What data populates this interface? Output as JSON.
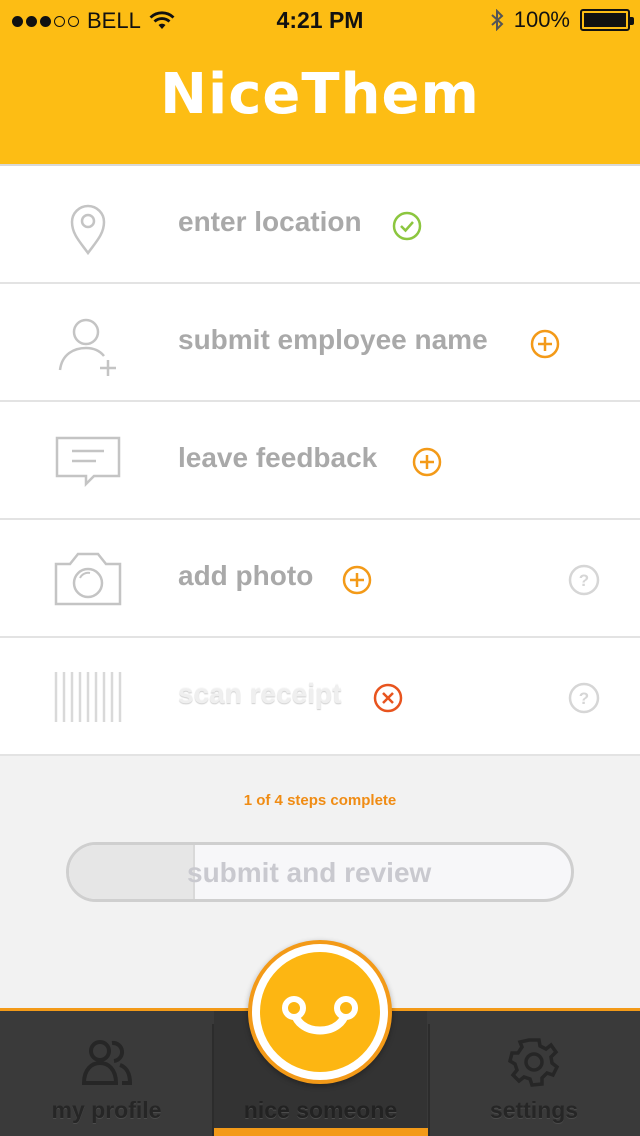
{
  "status_bar": {
    "carrier": "BELL",
    "time": "4:21 PM",
    "battery": "100%"
  },
  "header": {
    "logo": "NiceThem"
  },
  "steps": [
    {
      "label": "enter location",
      "status": "complete",
      "icon": "location-pin-icon"
    },
    {
      "label": "submit employee name",
      "status": "add",
      "icon": "add-person-icon"
    },
    {
      "label": "leave feedback",
      "status": "add",
      "icon": "speech-bubble-icon"
    },
    {
      "label": "add photo",
      "status": "add",
      "icon": "camera-icon",
      "help": true
    },
    {
      "label": "scan receipt",
      "status": "remove",
      "icon": "barcode-icon",
      "help": true
    }
  ],
  "progress": {
    "text": "1 of 4 steps complete",
    "completed": 1,
    "total": 4
  },
  "submit": {
    "label": "submit and review"
  },
  "tabs": [
    {
      "label": "my profile",
      "icon": "people-icon"
    },
    {
      "label": "nice someone",
      "icon": "smiley-icon",
      "active": true
    },
    {
      "label": "settings",
      "icon": "gear-icon"
    }
  ],
  "colors": {
    "brand": "#fdbd14",
    "accent": "#f39a18",
    "check": "#8cc63f",
    "remove": "#e8541e",
    "muted": "#a9a9a9"
  }
}
